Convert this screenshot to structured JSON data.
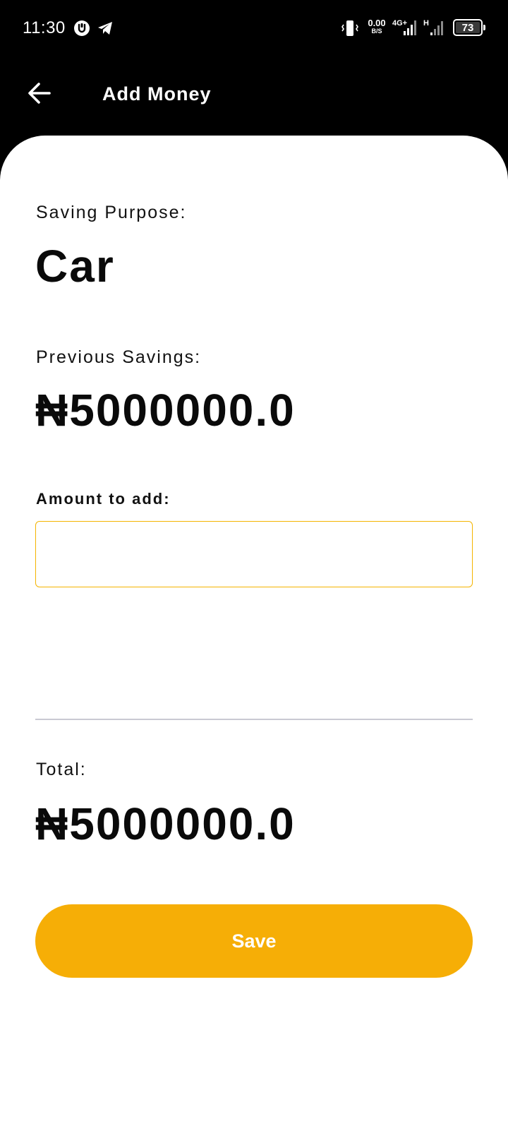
{
  "status_bar": {
    "time": "11:30",
    "net_speed_value": "0.00",
    "net_speed_unit": "B/S",
    "network_type": "4G+",
    "network_type_2": "H",
    "battery_level": "73",
    "icons": [
      "u-app-icon",
      "telegram-icon",
      "vibrate-icon",
      "signal-4g-icon",
      "signal-h-icon",
      "battery-icon"
    ]
  },
  "app_bar": {
    "title": "Add Money",
    "back_icon": "arrow-left-icon"
  },
  "saving": {
    "purpose_label": "Saving Purpose:",
    "purpose_value": "Car",
    "previous_label": "Previous Savings:",
    "previous_value": "₦5000000.0"
  },
  "form": {
    "amount_label": "Amount to add:",
    "amount_value": "",
    "amount_placeholder": ""
  },
  "total": {
    "label": "Total:",
    "value": "₦5000000.0"
  },
  "actions": {
    "save_label": "Save"
  },
  "colors": {
    "accent": "#f6ae06",
    "input_border": "#f4b400",
    "background_header": "#000000",
    "card": "#ffffff"
  }
}
